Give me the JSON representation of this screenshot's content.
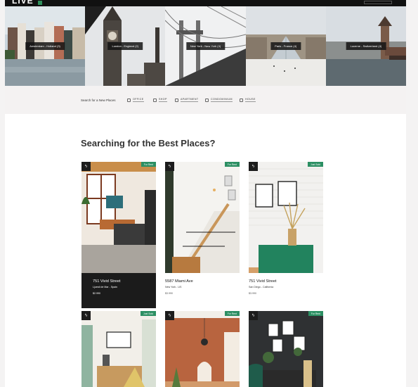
{
  "header": {
    "logo_text": "LIVE",
    "icon": "logo-square"
  },
  "cities": [
    {
      "label": "Amsterdam - Holland (3)"
    },
    {
      "label": "London - England (2)"
    },
    {
      "label": "New York - New York (4)"
    },
    {
      "label": "Paris - France (4)"
    },
    {
      "label": "Lucerne - Switzerland (4)"
    }
  ],
  "search": {
    "title": "Search for a New Places",
    "categories": [
      {
        "label": "OFFICE",
        "icon": "office-icon"
      },
      {
        "label": "SHOP",
        "icon": "shop-icon"
      },
      {
        "label": "APARTMENT",
        "icon": "apartment-icon"
      },
      {
        "label": "CONDOMINIUM",
        "icon": "condominium-icon"
      },
      {
        "label": "HOUSE",
        "icon": "house-icon"
      }
    ]
  },
  "main": {
    "heading": "Searching for the Best Places?",
    "listings": [
      {
        "badge": "For Rent",
        "title": "751 Vivid Street",
        "location": "Ljuesti de Mar - Spain",
        "price": "$2.990"
      },
      {
        "badge": "For Rent",
        "title": "5587 Miami Ave",
        "location": "New York - US",
        "price": "$3.990"
      },
      {
        "badge": "Just Sold",
        "title": "751 Vivid Street",
        "location": "San Diego - California",
        "price": "$3.990"
      },
      {
        "badge": "Just Sold",
        "title": "",
        "location": "",
        "price": ""
      },
      {
        "badge": "For Rent",
        "title": "",
        "location": "",
        "price": ""
      },
      {
        "badge": "For Rent",
        "title": "",
        "location": "",
        "price": ""
      }
    ]
  },
  "colors": {
    "accent": "#2c8f63",
    "dark": "#1b1b1b",
    "bg": "#f4f3f3"
  }
}
